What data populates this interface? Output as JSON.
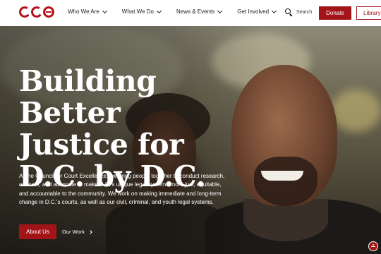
{
  "brand": {
    "logo_text": "cce",
    "accent_color": "#a31418"
  },
  "nav": {
    "items": [
      {
        "label": "Who We Are",
        "icon": "chevron-down-icon"
      },
      {
        "label": "What We Do",
        "icon": "chevron-down-icon"
      },
      {
        "label": "News & Events",
        "icon": "chevron-down-icon"
      },
      {
        "label": "Get Involved",
        "icon": "chevron-down-icon"
      }
    ],
    "search_label": "Search",
    "donate_label": "Donate",
    "library_label": "Library"
  },
  "hero": {
    "headline": "Building Better Justice for D.C. by D.C.",
    "intro": "At the Council for Court Excellence, we bring people together to conduct research, educate, and advocate to make D.C.'s unique legal systems more just, equitable, and accountable to the community. We work on making immediate and long-term change in D.C.'s courts, as well as our civil, criminal, and youth legal systems.",
    "primary_cta": "About Us",
    "secondary_cta": "Our Work",
    "image": "smiling-man-with-group-photo"
  },
  "accessibility": {
    "icon": "accessibility-icon"
  }
}
